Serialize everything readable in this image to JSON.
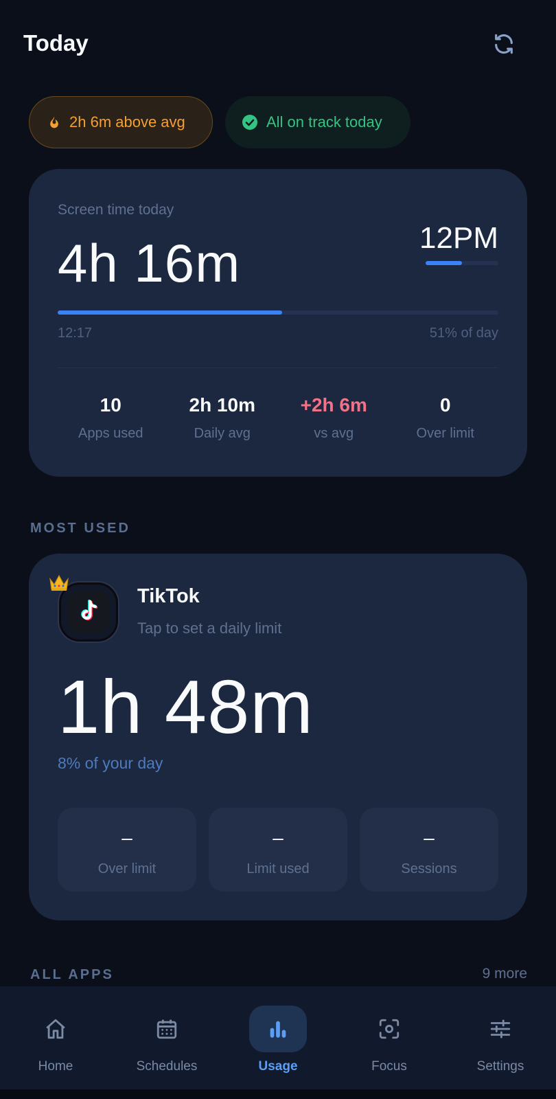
{
  "header": {
    "title": "Today",
    "refresh_icon": "refresh-icon"
  },
  "pills": {
    "warning": {
      "text": "2h 6m above avg",
      "icon": "flame-icon",
      "color": "#f5a031"
    },
    "ok": {
      "text": "All on track today",
      "icon": "check-circle-icon",
      "color": "#34c382"
    }
  },
  "summary": {
    "label": "Screen time today",
    "total": "4h 16m",
    "current_hour": "12PM",
    "hour_progress": 0.5,
    "day_start": "12:17",
    "day_pct_text": "51% of day",
    "day_progress": 0.51,
    "stats": [
      {
        "value": "10",
        "label": "Apps used"
      },
      {
        "value": "2h 10m",
        "label": "Daily avg"
      },
      {
        "value": "+2h 6m",
        "label": "vs avg"
      },
      {
        "value": "0",
        "label": "Over limit"
      }
    ]
  },
  "most_used": {
    "section_title": "MOST USED",
    "app_name": "TikTok",
    "app_icon": "tiktok-icon",
    "badge_icon": "crown-icon",
    "subtitle": "Tap to set a daily limit",
    "time": "1h 48m",
    "pct_text": "8% of your day",
    "mini": [
      {
        "value": "–",
        "label": "Over limit"
      },
      {
        "value": "–",
        "label": "Limit used"
      },
      {
        "value": "–",
        "label": "Sessions"
      }
    ]
  },
  "all_apps": {
    "section_title": "ALL APPS",
    "more": "9 more"
  },
  "nav": [
    {
      "label": "Home",
      "icon": "home-icon"
    },
    {
      "label": "Schedules",
      "icon": "calendar-icon"
    },
    {
      "label": "Usage",
      "icon": "bar-chart-icon",
      "active": true
    },
    {
      "label": "Focus",
      "icon": "focus-icon"
    },
    {
      "label": "Settings",
      "icon": "sliders-icon"
    }
  ],
  "colors": {
    "accent": "#3b82f6",
    "danger": "#f27287",
    "background": "#0a0f1a",
    "card": "#1c2740"
  }
}
